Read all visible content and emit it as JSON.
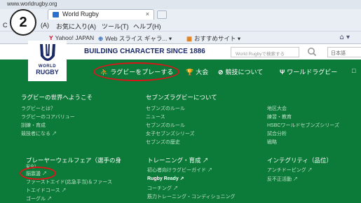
{
  "browser": {
    "url": "www.worldrugby.org",
    "tab_title": "World Rugby",
    "tab_close": "×",
    "menu": [
      "(A)",
      "お気に入り(A)",
      "ツール(T)",
      "ヘルプ(H)"
    ],
    "menu_left_clip": "C",
    "favorites": [
      {
        "icon": "Y",
        "label": "Yahoo! JAPAN"
      },
      {
        "icon": "⊕",
        "label": "Web スライス ギャラ... ▾"
      },
      {
        "icon": "▦",
        "label": "おすすめサイト ▾"
      }
    ],
    "tools": "⌂ ▾"
  },
  "step_badge": "2",
  "site": {
    "logo_top": "WORLD",
    "logo_bottom": "RUGBY",
    "tagline": "BUILDING CHARACTER SINCE 1886",
    "search_placeholder": "World Rugbyで検索する",
    "language": "日本語"
  },
  "nav": {
    "items": [
      {
        "icon": "runner-icon",
        "glyph": "⛹",
        "label": "ラグビーをプレーする"
      },
      {
        "icon": "trophy-icon",
        "glyph": "🏆",
        "label": "大会"
      },
      {
        "icon": "whistle-icon",
        "glyph": "⊘",
        "label": "競技について"
      },
      {
        "icon": "world-rugby-icon",
        "glyph": "Ψ",
        "label": "ワールドラグビー"
      },
      {
        "icon": "more-icon",
        "glyph": "□",
        "label": ""
      }
    ]
  },
  "mega_menu": {
    "col1": {
      "heading": "ラグビーの世界へようこそ",
      "links": [
        "ラグビーとは？",
        "ラグビーのコアバリュー",
        "訓練・育成",
        "競技者になる ↗"
      ]
    },
    "col2": {
      "heading": "セブンズラグビーについて",
      "links": [
        "セブンズのルール",
        "ニュース",
        "セブンズのルール",
        "女子セブンズシリーズ",
        "セブンズの歴史"
      ]
    },
    "col3": {
      "links": [
        "地区大会",
        "練習・教育",
        "HSBCワールドセブンズシリーズ",
        "試合分析",
        "戦略"
      ]
    },
    "col4": {
      "heading": "プレーヤーウェルフェア（選手の身",
      "heading_clip": "安全）",
      "links": [
        "脳震盪 ↗",
        "ファーストエイド(応急手当)＆ファース",
        "トエイドコース ↗",
        "ゴーグル ↗"
      ]
    },
    "col5": {
      "heading": "トレーニング・育成 ↗",
      "links": [
        "初心者向けラグビーガイド ↗",
        "Rugby Ready ↗",
        "コーチング ↗",
        "筋力トレーニング・コンディショニング"
      ]
    },
    "col6": {
      "heading": "インテグリティ（品位）",
      "links": [
        "アンチドーピング ↗",
        "反不正活動 ↗"
      ]
    }
  },
  "colors": {
    "nav_green": "#0c7a38",
    "brand_navy": "#1b2a66",
    "highlight_red": "#d7151b"
  }
}
